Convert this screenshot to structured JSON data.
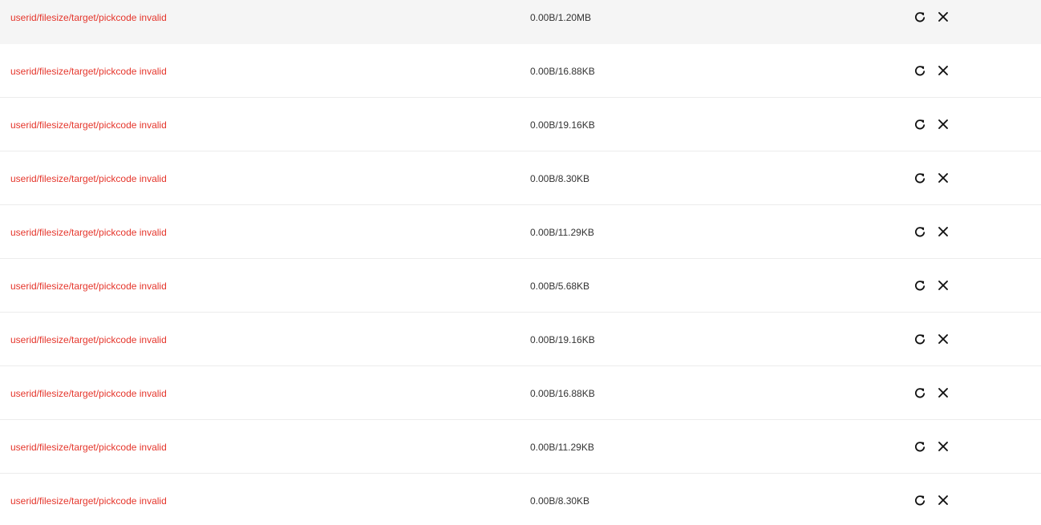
{
  "colors": {
    "error_text": "#e5352b",
    "size_text": "#333333",
    "hover_row_bg": "#f5f5f5",
    "divider": "#ececec"
  },
  "icons": {
    "retry": "refresh-icon",
    "remove": "close-icon"
  },
  "transfers": [
    {
      "status": "userid/filesize/target/pickcode invalid",
      "size": "0.00B/1.20MB",
      "hovered": true
    },
    {
      "status": "userid/filesize/target/pickcode invalid",
      "size": "0.00B/16.88KB"
    },
    {
      "status": "userid/filesize/target/pickcode invalid",
      "size": "0.00B/19.16KB"
    },
    {
      "status": "userid/filesize/target/pickcode invalid",
      "size": "0.00B/8.30KB"
    },
    {
      "status": "userid/filesize/target/pickcode invalid",
      "size": "0.00B/11.29KB"
    },
    {
      "status": "userid/filesize/target/pickcode invalid",
      "size": "0.00B/5.68KB"
    },
    {
      "status": "userid/filesize/target/pickcode invalid",
      "size": "0.00B/19.16KB"
    },
    {
      "status": "userid/filesize/target/pickcode invalid",
      "size": "0.00B/16.88KB"
    },
    {
      "status": "userid/filesize/target/pickcode invalid",
      "size": "0.00B/11.29KB"
    },
    {
      "status": "userid/filesize/target/pickcode invalid",
      "size": "0.00B/8.30KB"
    }
  ]
}
